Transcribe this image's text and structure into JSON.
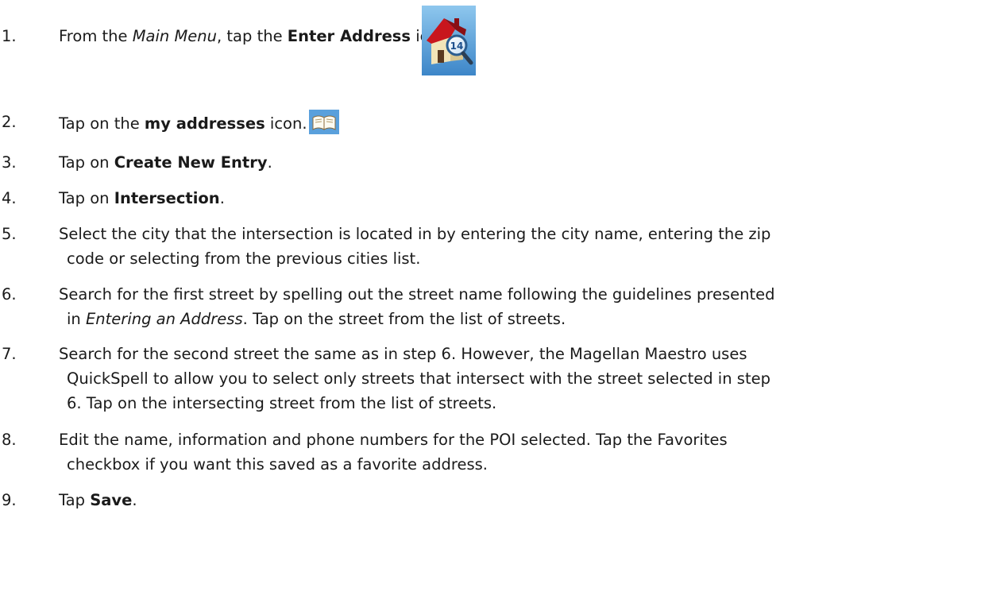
{
  "steps": [
    {
      "number": "1.",
      "parts": [
        "From the ",
        "Main Menu",
        ", tap the ",
        "Enter Address",
        " icon."
      ],
      "icon": "enter-address-icon"
    },
    {
      "number": "2.",
      "parts": [
        "Tap on the ",
        "my addresses",
        " icon."
      ],
      "icon": "my-addresses-book-icon"
    },
    {
      "number": "3.",
      "parts": [
        "Tap on ",
        "Create New Entry",
        "."
      ]
    },
    {
      "number": "4.",
      "parts": [
        "Tap on ",
        "Intersection",
        "."
      ]
    },
    {
      "number": "5.",
      "lines": [
        "Select the city that the intersection is located in by entering the city name, entering the zip",
        "code or selecting from the previous cities list."
      ]
    },
    {
      "number": "6.",
      "lines": [
        "Search for the first street by spelling out the street name following the guidelines presented",
        "in "
      ],
      "italic": "Entering an Address",
      "tail": ".  Tap on the street from the list of streets."
    },
    {
      "number": "7.",
      "lines": [
        "Search for the second street the same as in step 6.  However, the Magellan Maestro uses",
        "QuickSpell to allow you to select only streets that intersect with the street selected in step",
        "6.  Tap on the intersecting street from the list of streets."
      ]
    },
    {
      "number": "8.",
      "lines": [
        "Edit the name, information and phone numbers for the POI selected.  Tap the Favorites",
        "checkbox if you want this saved as a favorite address."
      ]
    },
    {
      "number": "9.",
      "parts": [
        "Tap ",
        "Save",
        "."
      ]
    }
  ],
  "icon_badge_number": "14"
}
